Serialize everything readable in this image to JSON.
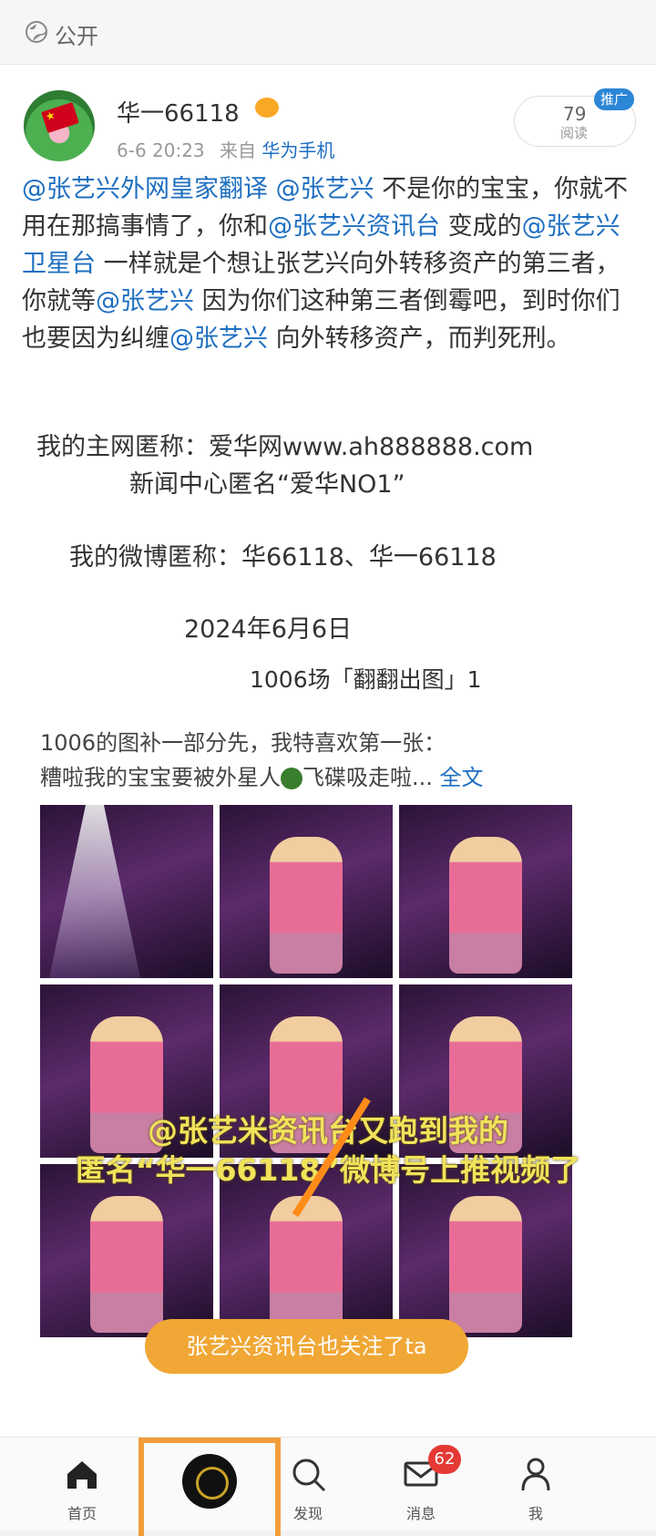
{
  "header": {
    "visibility": "公开"
  },
  "post": {
    "username": "华一66118",
    "time": "6-6 20:23",
    "source_prefix": "来自",
    "source": "华为手机",
    "reads": "79",
    "reads_label": "阅读",
    "promo": "推广",
    "body": [
      {
        "t": "@张艺兴外网皇家翻译 @张艺兴",
        "m": true
      },
      {
        "t": " 不是你的宝宝，你就不用在那搞事情了，你和",
        "m": false
      },
      {
        "t": "@张艺兴资讯台",
        "m": true
      },
      {
        "t": " 变成的",
        "m": false
      },
      {
        "t": "@张艺兴卫星台",
        "m": true
      },
      {
        "t": " 一样就是个想让张艺兴向外转移资产的第三者，你就等",
        "m": false
      },
      {
        "t": "@张艺兴",
        "m": true
      },
      {
        "t": " 因为你们这种第三者倒霉吧，到时你们也要因为纠缠",
        "m": false
      },
      {
        "t": "@张艺兴",
        "m": true
      },
      {
        "t": " 向外转移资产，而判死刑。",
        "m": false
      }
    ],
    "signature": {
      "line1": "我的主网匿称：爱华网www.ah888888.com",
      "line2": "新闻中心匿名“爱华NO1”",
      "line3": "我的微博匿称：华66118、华一66118",
      "date": "2024年6月6日"
    }
  },
  "quoted": {
    "title": "1006场「翻翻出图」1",
    "text_line1": "1006的图补一部分先，我特喜欢第一张：",
    "text_line2_a": "糟啦我的宝宝要被外星人",
    "text_line2_b": "飞碟吸走啦...",
    "more": "全文",
    "overlay_line1": "@张艺米资讯台又跑到我的",
    "overlay_line2": "匿名“华一66118”微博号上推视频了",
    "toast": "张艺兴资讯台也关注了ta"
  },
  "tabbar": {
    "home": "首页",
    "discover": "发现",
    "messages": "消息",
    "messages_badge": "62",
    "me": "我"
  },
  "colors": {
    "accent": "#1e6fc1",
    "toast": "#f0a735",
    "badge": "#e53935",
    "promo": "#2b86d6"
  }
}
